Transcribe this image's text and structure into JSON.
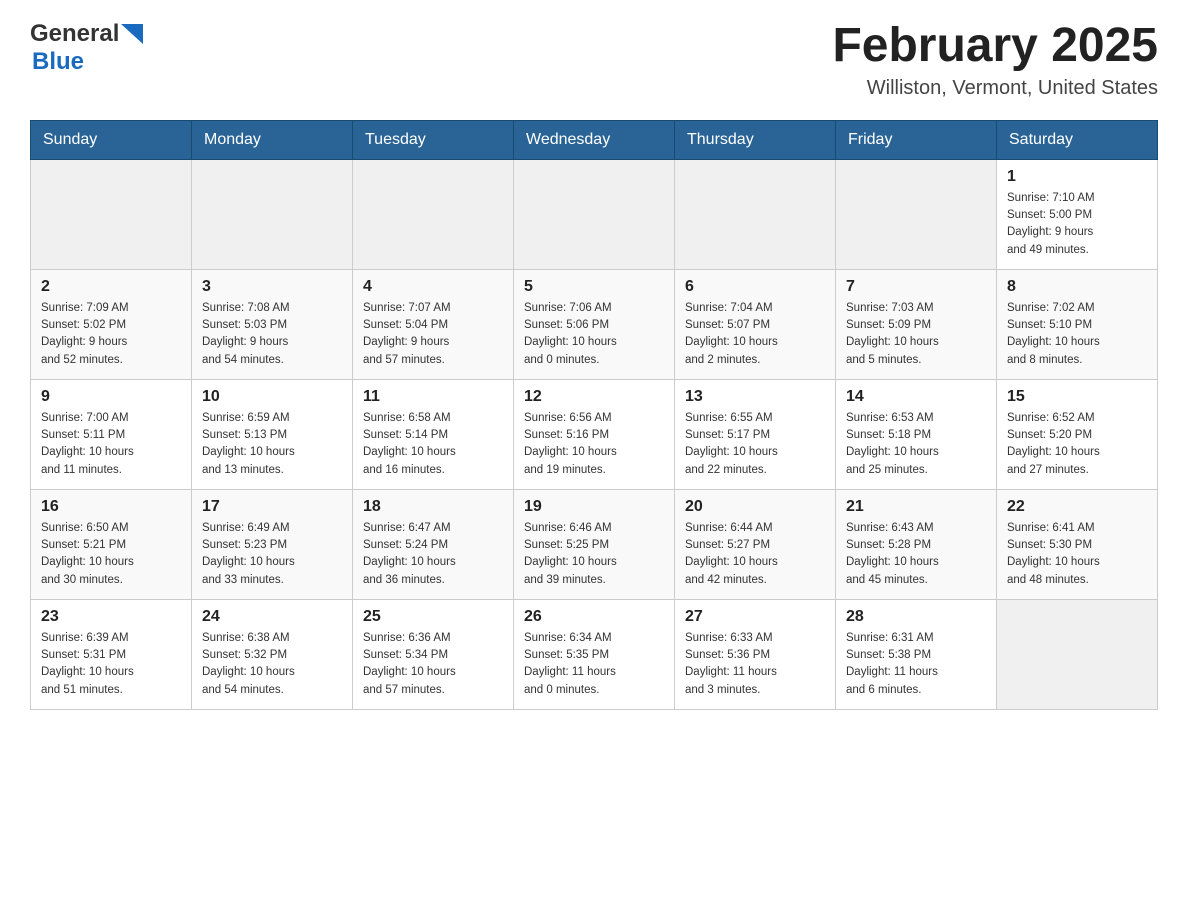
{
  "header": {
    "logo_general": "General",
    "logo_blue": "Blue",
    "month_title": "February 2025",
    "location": "Williston, Vermont, United States"
  },
  "weekdays": [
    "Sunday",
    "Monday",
    "Tuesday",
    "Wednesday",
    "Thursday",
    "Friday",
    "Saturday"
  ],
  "weeks": [
    [
      {
        "day": "",
        "info": ""
      },
      {
        "day": "",
        "info": ""
      },
      {
        "day": "",
        "info": ""
      },
      {
        "day": "",
        "info": ""
      },
      {
        "day": "",
        "info": ""
      },
      {
        "day": "",
        "info": ""
      },
      {
        "day": "1",
        "info": "Sunrise: 7:10 AM\nSunset: 5:00 PM\nDaylight: 9 hours\nand 49 minutes."
      }
    ],
    [
      {
        "day": "2",
        "info": "Sunrise: 7:09 AM\nSunset: 5:02 PM\nDaylight: 9 hours\nand 52 minutes."
      },
      {
        "day": "3",
        "info": "Sunrise: 7:08 AM\nSunset: 5:03 PM\nDaylight: 9 hours\nand 54 minutes."
      },
      {
        "day": "4",
        "info": "Sunrise: 7:07 AM\nSunset: 5:04 PM\nDaylight: 9 hours\nand 57 minutes."
      },
      {
        "day": "5",
        "info": "Sunrise: 7:06 AM\nSunset: 5:06 PM\nDaylight: 10 hours\nand 0 minutes."
      },
      {
        "day": "6",
        "info": "Sunrise: 7:04 AM\nSunset: 5:07 PM\nDaylight: 10 hours\nand 2 minutes."
      },
      {
        "day": "7",
        "info": "Sunrise: 7:03 AM\nSunset: 5:09 PM\nDaylight: 10 hours\nand 5 minutes."
      },
      {
        "day": "8",
        "info": "Sunrise: 7:02 AM\nSunset: 5:10 PM\nDaylight: 10 hours\nand 8 minutes."
      }
    ],
    [
      {
        "day": "9",
        "info": "Sunrise: 7:00 AM\nSunset: 5:11 PM\nDaylight: 10 hours\nand 11 minutes."
      },
      {
        "day": "10",
        "info": "Sunrise: 6:59 AM\nSunset: 5:13 PM\nDaylight: 10 hours\nand 13 minutes."
      },
      {
        "day": "11",
        "info": "Sunrise: 6:58 AM\nSunset: 5:14 PM\nDaylight: 10 hours\nand 16 minutes."
      },
      {
        "day": "12",
        "info": "Sunrise: 6:56 AM\nSunset: 5:16 PM\nDaylight: 10 hours\nand 19 minutes."
      },
      {
        "day": "13",
        "info": "Sunrise: 6:55 AM\nSunset: 5:17 PM\nDaylight: 10 hours\nand 22 minutes."
      },
      {
        "day": "14",
        "info": "Sunrise: 6:53 AM\nSunset: 5:18 PM\nDaylight: 10 hours\nand 25 minutes."
      },
      {
        "day": "15",
        "info": "Sunrise: 6:52 AM\nSunset: 5:20 PM\nDaylight: 10 hours\nand 27 minutes."
      }
    ],
    [
      {
        "day": "16",
        "info": "Sunrise: 6:50 AM\nSunset: 5:21 PM\nDaylight: 10 hours\nand 30 minutes."
      },
      {
        "day": "17",
        "info": "Sunrise: 6:49 AM\nSunset: 5:23 PM\nDaylight: 10 hours\nand 33 minutes."
      },
      {
        "day": "18",
        "info": "Sunrise: 6:47 AM\nSunset: 5:24 PM\nDaylight: 10 hours\nand 36 minutes."
      },
      {
        "day": "19",
        "info": "Sunrise: 6:46 AM\nSunset: 5:25 PM\nDaylight: 10 hours\nand 39 minutes."
      },
      {
        "day": "20",
        "info": "Sunrise: 6:44 AM\nSunset: 5:27 PM\nDaylight: 10 hours\nand 42 minutes."
      },
      {
        "day": "21",
        "info": "Sunrise: 6:43 AM\nSunset: 5:28 PM\nDaylight: 10 hours\nand 45 minutes."
      },
      {
        "day": "22",
        "info": "Sunrise: 6:41 AM\nSunset: 5:30 PM\nDaylight: 10 hours\nand 48 minutes."
      }
    ],
    [
      {
        "day": "23",
        "info": "Sunrise: 6:39 AM\nSunset: 5:31 PM\nDaylight: 10 hours\nand 51 minutes."
      },
      {
        "day": "24",
        "info": "Sunrise: 6:38 AM\nSunset: 5:32 PM\nDaylight: 10 hours\nand 54 minutes."
      },
      {
        "day": "25",
        "info": "Sunrise: 6:36 AM\nSunset: 5:34 PM\nDaylight: 10 hours\nand 57 minutes."
      },
      {
        "day": "26",
        "info": "Sunrise: 6:34 AM\nSunset: 5:35 PM\nDaylight: 11 hours\nand 0 minutes."
      },
      {
        "day": "27",
        "info": "Sunrise: 6:33 AM\nSunset: 5:36 PM\nDaylight: 11 hours\nand 3 minutes."
      },
      {
        "day": "28",
        "info": "Sunrise: 6:31 AM\nSunset: 5:38 PM\nDaylight: 11 hours\nand 6 minutes."
      },
      {
        "day": "",
        "info": ""
      }
    ]
  ]
}
